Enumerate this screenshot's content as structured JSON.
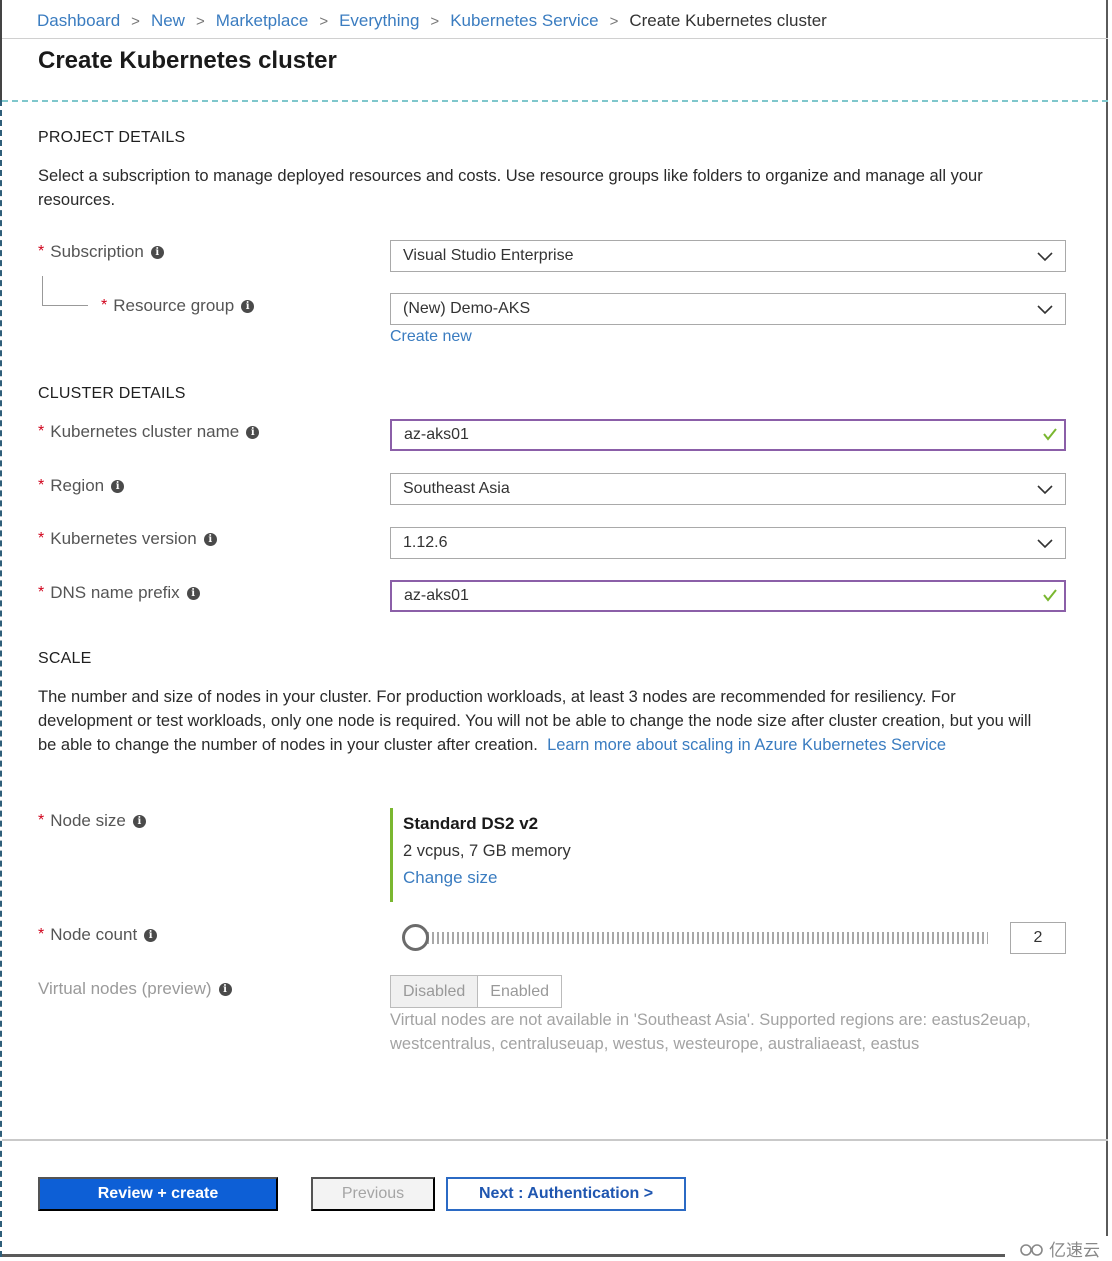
{
  "breadcrumb": [
    "Dashboard",
    "New",
    "Marketplace",
    "Everything",
    "Kubernetes Service",
    "Create Kubernetes cluster"
  ],
  "page_title": "Create Kubernetes cluster",
  "project_details": {
    "title": "PROJECT DETAILS",
    "description": "Select a subscription to manage deployed resources and costs. Use resource groups like folders to organize and manage all your resources.",
    "subscription": {
      "label": "Subscription",
      "value": "Visual Studio Enterprise"
    },
    "resource_group": {
      "label": "Resource group",
      "value": "(New) Demo-AKS",
      "create_new": "Create new"
    }
  },
  "cluster_details": {
    "title": "CLUSTER DETAILS",
    "cluster_name": {
      "label": "Kubernetes cluster name",
      "value": "az-aks01"
    },
    "region": {
      "label": "Region",
      "value": "Southeast Asia"
    },
    "version": {
      "label": "Kubernetes version",
      "value": "1.12.6"
    },
    "dns_prefix": {
      "label": "DNS name prefix",
      "value": "az-aks01"
    }
  },
  "scale": {
    "title": "SCALE",
    "description": "The number and size of nodes in your cluster. For production workloads, at least 3 nodes are recommended for resiliency. For development or test workloads, only one node is required. You will not be able to change the node size after cluster creation, but you will be able to change the number of nodes in your cluster after creation.",
    "learn_more": "Learn more about scaling in Azure Kubernetes Service",
    "node_size": {
      "label": "Node size",
      "name": "Standard DS2 v2",
      "spec": "2 vcpus, 7 GB memory",
      "change": "Change size"
    },
    "node_count": {
      "label": "Node count",
      "value": "2"
    },
    "virtual_nodes": {
      "label": "Virtual nodes (preview)",
      "options": [
        "Disabled",
        "Enabled"
      ],
      "selected": "Disabled",
      "note": "Virtual nodes are not available in 'Southeast Asia'. Supported regions are: eastus2euap, westcentralus, centraluseuap, westus, westeurope, australiaeast, eastus"
    }
  },
  "footer": {
    "review_create": "Review + create",
    "previous": "Previous",
    "next": "Next : Authentication >"
  },
  "required_mark": "*",
  "info_glyph": "i",
  "watermark": "亿速云",
  "colors": {
    "link": "#3a7cc0",
    "primary": "#0d5fd6",
    "valid_border": "#8b5fa8",
    "check": "#7ab730",
    "required": "#d0021b"
  }
}
